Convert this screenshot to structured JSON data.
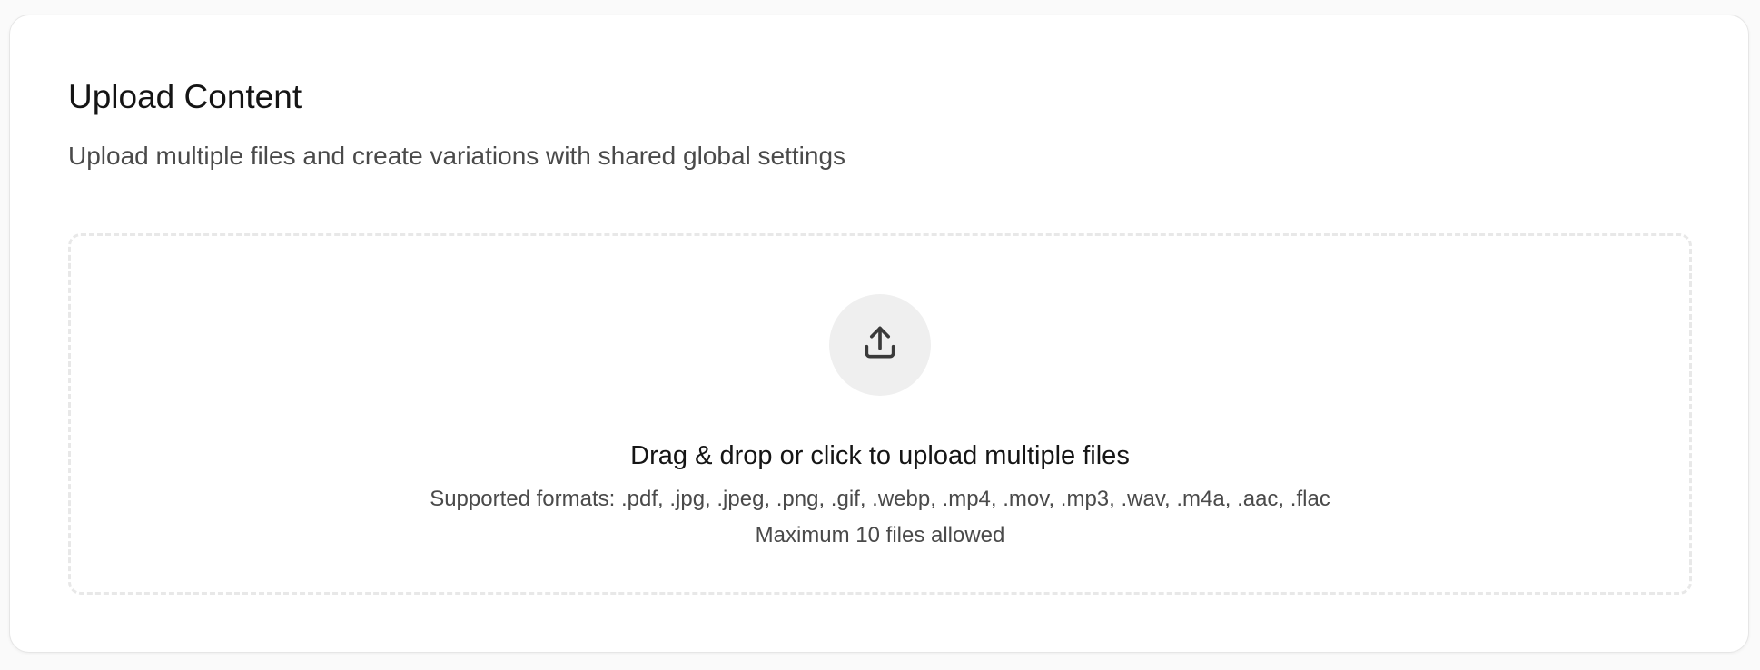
{
  "header": {
    "title": "Upload Content",
    "subtitle": "Upload multiple files and create variations with shared global settings"
  },
  "dropzone": {
    "icon": "upload-icon",
    "title": "Drag & drop or click to upload multiple files",
    "formats": "Supported formats: .pdf, .jpg, .jpeg, .png, .gif, .webp, .mp4, .mov, .mp3, .wav, .m4a, .aac, .flac",
    "limit": "Maximum 10 files allowed"
  },
  "colors": {
    "card_background": "#ffffff",
    "icon_circle": "#efefef",
    "icon_stroke": "#3a3a3a",
    "dashed_border": "#e8e8e8"
  }
}
